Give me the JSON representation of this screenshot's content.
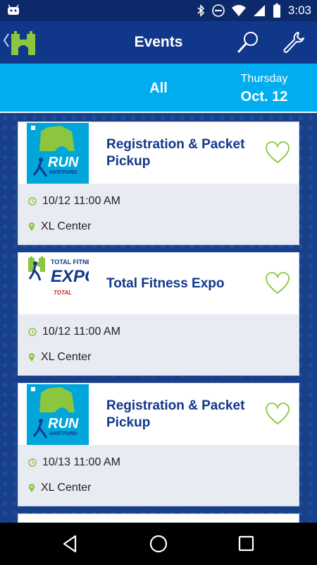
{
  "status_bar": {
    "time": "3:03"
  },
  "app_bar": {
    "title": "Events"
  },
  "tabs": {
    "all_label": "All",
    "day_of_week": "Thursday",
    "date": "Oct. 12"
  },
  "colors": {
    "brand_blue": "#11378a",
    "accent_cyan": "#00aeef",
    "accent_green": "#8cc63f"
  },
  "events": [
    {
      "name": "Registration & Packet Pickup",
      "time": "10/12 11:00 AM",
      "location": "XL Center",
      "thumb": "run-hartford-logo",
      "favorite": false
    },
    {
      "name": "Total Fitness Expo",
      "time": "10/12 11:00 AM",
      "location": "XL Center",
      "thumb": "total-fitness-expo-logo",
      "favorite": false
    },
    {
      "name": "Registration & Packet Pickup",
      "time": "10/13 11:00 AM",
      "location": "XL Center",
      "thumb": "run-hartford-logo",
      "favorite": false
    }
  ],
  "thumb_text": {
    "run": "RUN",
    "hartford": "HARTFORD",
    "expo_top": "TOTAL FITNESS",
    "expo": "EXPO",
    "sponsor": "TOTAL"
  }
}
